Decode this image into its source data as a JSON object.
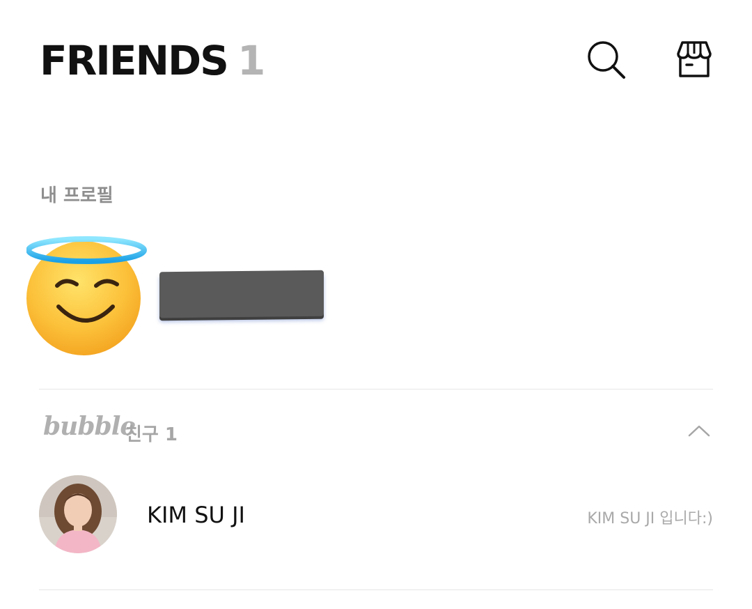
{
  "header": {
    "title": "FRIENDS",
    "count": "1",
    "search_icon": "search-icon",
    "shop_icon": "store-icon"
  },
  "my_profile": {
    "section_label": "내 프로필",
    "avatar_icon": "smiling-face-with-halo-emoji",
    "name_redacted": true
  },
  "bubble_group": {
    "logo": "bubble",
    "label": "친구 1",
    "collapse_icon": "chevron-up-icon",
    "friends": [
      {
        "name": "KIM SU JI",
        "status": "KIM SU JI 입니다:)"
      }
    ]
  },
  "colors": {
    "title": "#111111",
    "count": "#b4b4b4",
    "muted": "#8e8e8e",
    "divider": "#e6e6e6"
  }
}
